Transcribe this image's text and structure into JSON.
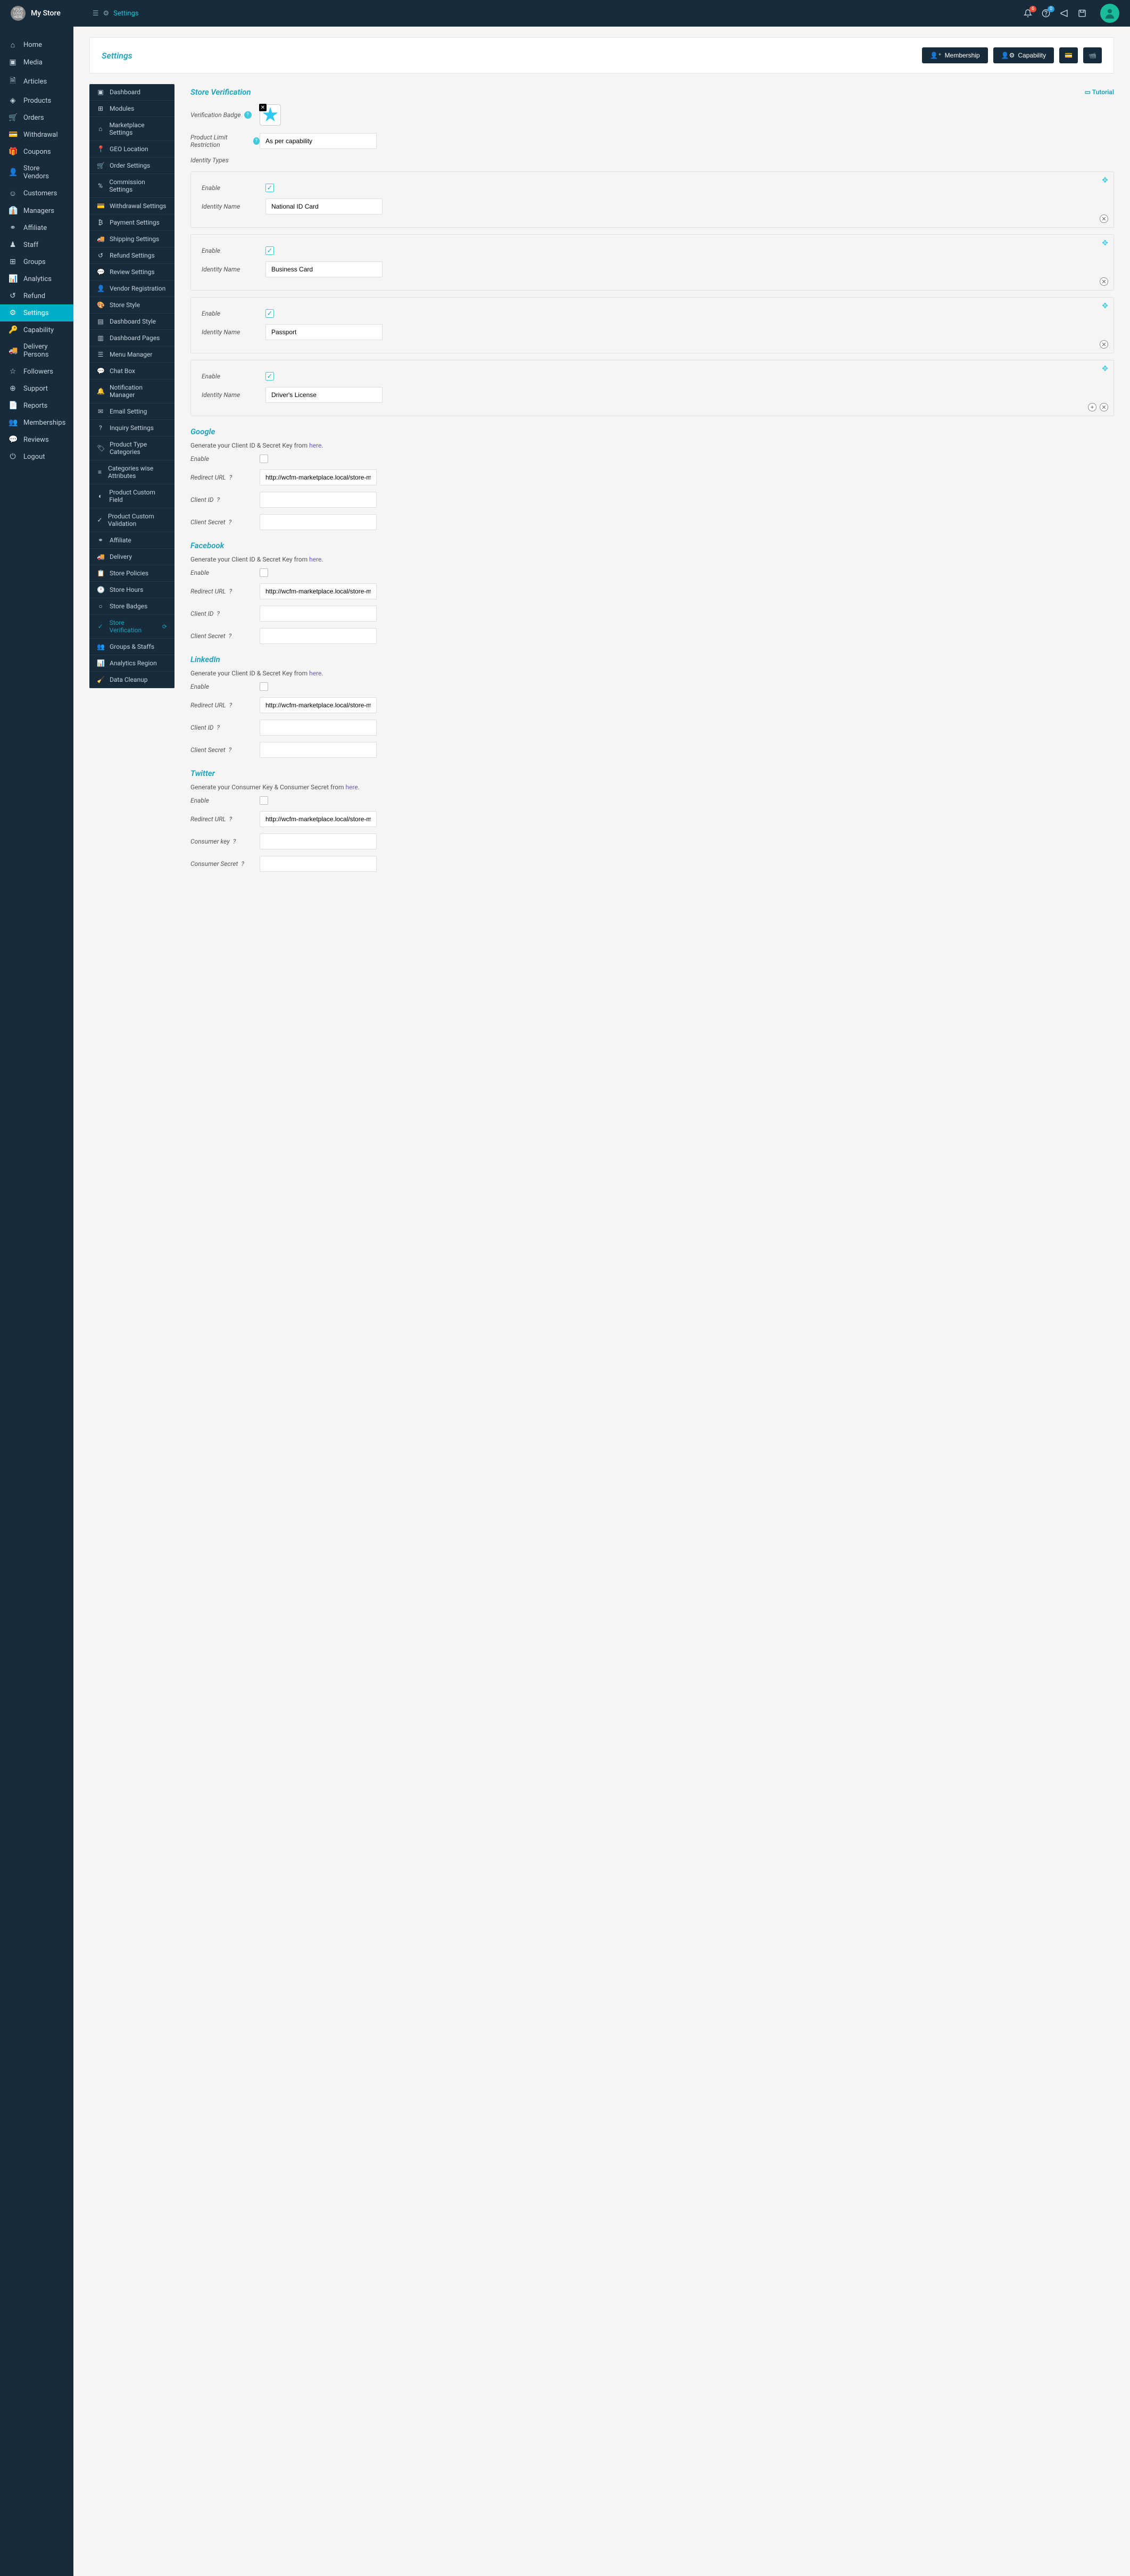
{
  "topbar": {
    "logo_text": "YOUR LOGO HERE",
    "store_name": "My Store",
    "breadcrumb": "Settings",
    "notif_count": "6",
    "help_count": "0"
  },
  "sidebar": {
    "items": [
      {
        "icon": "⌂",
        "label": "Home"
      },
      {
        "icon": "▣",
        "label": "Media"
      },
      {
        "icon": "🗎",
        "label": "Articles"
      },
      {
        "icon": "◈",
        "label": "Products"
      },
      {
        "icon": "🛒",
        "label": "Orders"
      },
      {
        "icon": "💳",
        "label": "Withdrawal"
      },
      {
        "icon": "🎁",
        "label": "Coupons"
      },
      {
        "icon": "👤",
        "label": "Store Vendors"
      },
      {
        "icon": "☺",
        "label": "Customers"
      },
      {
        "icon": "👔",
        "label": "Managers"
      },
      {
        "icon": "⚭",
        "label": "Affiliate"
      },
      {
        "icon": "♟",
        "label": "Staff"
      },
      {
        "icon": "⊞",
        "label": "Groups"
      },
      {
        "icon": "📊",
        "label": "Analytics"
      },
      {
        "icon": "↺",
        "label": "Refund"
      },
      {
        "icon": "⚙",
        "label": "Settings",
        "active": true
      },
      {
        "icon": "🔑",
        "label": "Capability"
      },
      {
        "icon": "🚚",
        "label": "Delivery Persons"
      },
      {
        "icon": "☆",
        "label": "Followers"
      },
      {
        "icon": "⊕",
        "label": "Support"
      },
      {
        "icon": "📄",
        "label": "Reports"
      },
      {
        "icon": "👥",
        "label": "Memberships"
      },
      {
        "icon": "💬",
        "label": "Reviews"
      },
      {
        "icon": "⏻",
        "label": "Logout"
      }
    ]
  },
  "panel": {
    "title": "Settings",
    "btn_membership": "Membership",
    "btn_capability": "Capability"
  },
  "subnav": {
    "items": [
      {
        "icon": "▣",
        "label": "Dashboard"
      },
      {
        "icon": "⊞",
        "label": "Modules"
      },
      {
        "icon": "⌂",
        "label": "Marketplace Settings"
      },
      {
        "icon": "📍",
        "label": "GEO Location"
      },
      {
        "icon": "🛒",
        "label": "Order Settings"
      },
      {
        "icon": "%",
        "label": "Commission Settings"
      },
      {
        "icon": "💳",
        "label": "Withdrawal Settings"
      },
      {
        "icon": "₿",
        "label": "Payment Settings"
      },
      {
        "icon": "🚚",
        "label": "Shipping Settings"
      },
      {
        "icon": "↺",
        "label": "Refund Settings"
      },
      {
        "icon": "💬",
        "label": "Review Settings"
      },
      {
        "icon": "👤",
        "label": "Vendor Registration"
      },
      {
        "icon": "🎨",
        "label": "Store Style"
      },
      {
        "icon": "▤",
        "label": "Dashboard Style"
      },
      {
        "icon": "▥",
        "label": "Dashboard Pages"
      },
      {
        "icon": "☰",
        "label": "Menu Manager"
      },
      {
        "icon": "💬",
        "label": "Chat Box"
      },
      {
        "icon": "🔔",
        "label": "Notification Manager"
      },
      {
        "icon": "✉",
        "label": "Email Setting"
      },
      {
        "icon": "?",
        "label": "Inquiry Settings"
      },
      {
        "icon": "🏷",
        "label": "Product Type Categories"
      },
      {
        "icon": "≡",
        "label": "Categories wise Attributes"
      },
      {
        "icon": "◐",
        "label": "Product Custom Field"
      },
      {
        "icon": "✓",
        "label": "Product Custom Validation"
      },
      {
        "icon": "⚭",
        "label": "Affiliate"
      },
      {
        "icon": "🚚",
        "label": "Delivery"
      },
      {
        "icon": "📋",
        "label": "Store Policies"
      },
      {
        "icon": "🕐",
        "label": "Store Hours"
      },
      {
        "icon": "○",
        "label": "Store Badges"
      },
      {
        "icon": "✓",
        "label": "Store Verification",
        "active": true
      },
      {
        "icon": "👥",
        "label": "Groups & Staffs"
      },
      {
        "icon": "📊",
        "label": "Analytics Region"
      },
      {
        "icon": "🧹",
        "label": "Data Cleanup"
      }
    ]
  },
  "main": {
    "section_title": "Store Verification",
    "tutorial": "Tutorial",
    "verification_badge_label": "Verification Badge",
    "product_limit_label": "Product Limit Restriction",
    "product_limit_value": "As per capability",
    "identity_types_label": "Identity Types",
    "identity": [
      {
        "enable_label": "Enable",
        "enabled": true,
        "name_label": "Identity Name",
        "name": "National ID Card"
      },
      {
        "enable_label": "Enable",
        "enabled": true,
        "name_label": "Identity Name",
        "name": "Business Card"
      },
      {
        "enable_label": "Enable",
        "enabled": true,
        "name_label": "Identity Name",
        "name": "Passport"
      },
      {
        "enable_label": "Enable",
        "enabled": true,
        "name_label": "Identity Name",
        "name": "Driver's License",
        "last": true
      }
    ],
    "social": [
      {
        "title": "Google",
        "gen_prefix": "Generate your Client ID & Secret Key from ",
        "gen_link": "here",
        "enable_label": "Enable",
        "redirect_label": "Redirect URL",
        "redirect_value": "http://wcfm-marketplace.local/store-manager/p",
        "id_label": "Client ID",
        "secret_label": "Client Secret"
      },
      {
        "title": "Facebook",
        "gen_prefix": "Generate your Client ID & Secret Key from ",
        "gen_link": "here",
        "enable_label": "Enable",
        "redirect_label": "Redirect URL",
        "redirect_value": "http://wcfm-marketplace.local/store-manager/p",
        "id_label": "Client ID",
        "secret_label": "Client Secret"
      },
      {
        "title": "LinkedIn",
        "gen_prefix": "Generate your Client ID & Secret Key from ",
        "gen_link": "here",
        "enable_label": "Enable",
        "redirect_label": "Redirect URL",
        "redirect_value": "http://wcfm-marketplace.local/store-manager/p",
        "id_label": "Client ID",
        "secret_label": "Client Secret"
      },
      {
        "title": "Twitter",
        "gen_prefix": "Generate your Consumer Key & Consumer Secret from ",
        "gen_link": "here",
        "enable_label": "Enable",
        "redirect_label": "Redirect URL",
        "redirect_value": "http://wcfm-marketplace.local/store-manager/p",
        "id_label": "Consumer key",
        "secret_label": "Consumer Secret"
      }
    ]
  }
}
